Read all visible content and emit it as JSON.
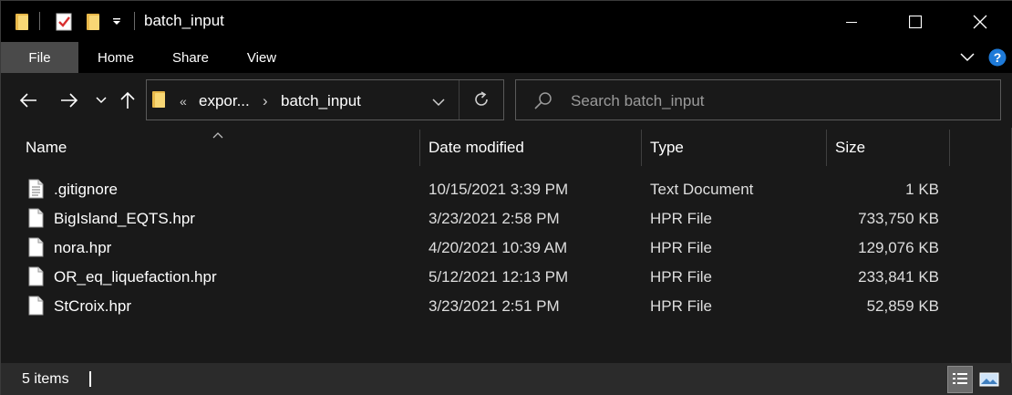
{
  "window": {
    "title": "batch_input"
  },
  "ribbon": {
    "tabs": [
      "File",
      "Home",
      "Share",
      "View"
    ]
  },
  "address": {
    "parent": "expor...",
    "current": "batch_input"
  },
  "search": {
    "placeholder": "Search batch_input"
  },
  "columns": {
    "name": "Name",
    "date": "Date modified",
    "type": "Type",
    "size": "Size"
  },
  "files": [
    {
      "name": ".gitignore",
      "date": "10/15/2021 3:39 PM",
      "type": "Text Document",
      "size": "1 KB",
      "icon": "text-document-icon"
    },
    {
      "name": "BigIsland_EQTS.hpr",
      "date": "3/23/2021 2:58 PM",
      "type": "HPR File",
      "size": "733,750 KB",
      "icon": "file-icon"
    },
    {
      "name": "nora.hpr",
      "date": "4/20/2021 10:39 AM",
      "type": "HPR File",
      "size": "129,076 KB",
      "icon": "file-icon"
    },
    {
      "name": "OR_eq_liquefaction.hpr",
      "date": "5/12/2021 12:13 PM",
      "type": "HPR File",
      "size": "233,841 KB",
      "icon": "file-icon"
    },
    {
      "name": "StCroix.hpr",
      "date": "3/23/2021 2:51 PM",
      "type": "HPR File",
      "size": "52,859 KB",
      "icon": "file-icon"
    }
  ],
  "status": {
    "count": "5 items"
  },
  "colors": {
    "folder": "#f8d775",
    "help": "#1e7ad8",
    "background": "#191919"
  }
}
